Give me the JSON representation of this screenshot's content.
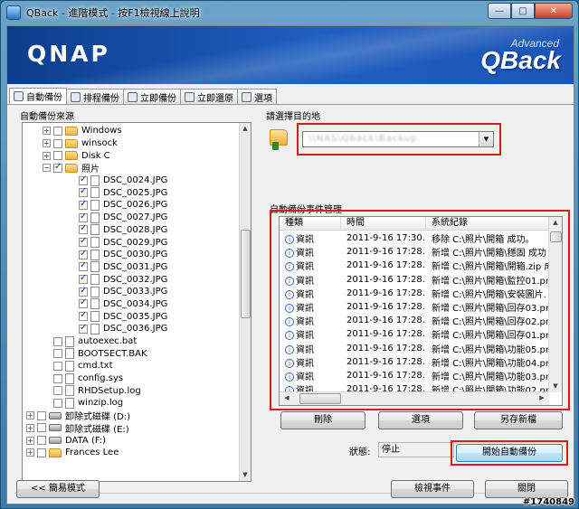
{
  "window": {
    "title": "QBack - 進階模式 - 按F1檢視線上說明",
    "minimize": "—",
    "maximize": "□",
    "close": "✕"
  },
  "banner": {
    "brand": "QNAP",
    "product_small": "Advanced",
    "product_big": "QBack"
  },
  "tabs": [
    {
      "label": "自動備份",
      "active": true
    },
    {
      "label": "排程備份",
      "active": false
    },
    {
      "label": "立即備份",
      "active": false
    },
    {
      "label": "立即還原",
      "active": false
    },
    {
      "label": "選項",
      "active": false
    }
  ],
  "source": {
    "title": "自動備份來源",
    "items": [
      {
        "label": "Windows",
        "depth": 1,
        "icon": "folder",
        "expander": "+",
        "checked": false
      },
      {
        "label": "winsock",
        "depth": 1,
        "icon": "folder",
        "expander": "+",
        "checked": false
      },
      {
        "label": "Disk C",
        "depth": 1,
        "icon": "folder",
        "expander": "+",
        "checked": false
      },
      {
        "label": "照片",
        "depth": 1,
        "icon": "folder",
        "expander": "−",
        "checked": true
      },
      {
        "label": "DSC_0024.JPG",
        "depth": 2,
        "icon": "file",
        "expander": "",
        "checked": true
      },
      {
        "label": "DSC_0025.JPG",
        "depth": 2,
        "icon": "file",
        "expander": "",
        "checked": true
      },
      {
        "label": "DSC_0026.JPG",
        "depth": 2,
        "icon": "file",
        "expander": "",
        "checked": true
      },
      {
        "label": "DSC_0027.JPG",
        "depth": 2,
        "icon": "file",
        "expander": "",
        "checked": true
      },
      {
        "label": "DSC_0028.JPG",
        "depth": 2,
        "icon": "file",
        "expander": "",
        "checked": true
      },
      {
        "label": "DSC_0029.JPG",
        "depth": 2,
        "icon": "file",
        "expander": "",
        "checked": true
      },
      {
        "label": "DSC_0030.JPG",
        "depth": 2,
        "icon": "file",
        "expander": "",
        "checked": true
      },
      {
        "label": "DSC_0031.JPG",
        "depth": 2,
        "icon": "file",
        "expander": "",
        "checked": true
      },
      {
        "label": "DSC_0032.JPG",
        "depth": 2,
        "icon": "file",
        "expander": "",
        "checked": true
      },
      {
        "label": "DSC_0033.JPG",
        "depth": 2,
        "icon": "file",
        "expander": "",
        "checked": true
      },
      {
        "label": "DSC_0034.JPG",
        "depth": 2,
        "icon": "file",
        "expander": "",
        "checked": true
      },
      {
        "label": "DSC_0035.JPG",
        "depth": 2,
        "icon": "file",
        "expander": "",
        "checked": true
      },
      {
        "label": "DSC_0036.JPG",
        "depth": 2,
        "icon": "file",
        "expander": "",
        "checked": true
      },
      {
        "label": "autoexec.bat",
        "depth": 1,
        "icon": "file",
        "expander": "",
        "checked": false
      },
      {
        "label": "BOOTSECT.BAK",
        "depth": 1,
        "icon": "file",
        "expander": "",
        "checked": false
      },
      {
        "label": "cmd.txt",
        "depth": 1,
        "icon": "file",
        "expander": "",
        "checked": false
      },
      {
        "label": "config.sys",
        "depth": 1,
        "icon": "file",
        "expander": "",
        "checked": false
      },
      {
        "label": "RHDSetup.log",
        "depth": 1,
        "icon": "file",
        "expander": "",
        "checked": false
      },
      {
        "label": "winzip.log",
        "depth": 1,
        "icon": "file",
        "expander": "",
        "checked": false
      },
      {
        "label": "卸除式磁碟 (D:)",
        "depth": 0,
        "icon": "drive",
        "expander": "+",
        "checked": false
      },
      {
        "label": "卸除式磁碟 (E:)",
        "depth": 0,
        "icon": "drive",
        "expander": "+",
        "checked": false
      },
      {
        "label": "DATA (F:)",
        "depth": 0,
        "icon": "drive",
        "expander": "+",
        "checked": false
      },
      {
        "label": "Frances Lee",
        "depth": 0,
        "icon": "folder",
        "expander": "+",
        "checked": false
      }
    ]
  },
  "destination": {
    "label": "請選擇目的地",
    "value": "\\\\NAS\\Qback\\Backup"
  },
  "log": {
    "label": "自動備份事件管理",
    "columns": [
      "種類",
      "時間",
      "系統紀錄"
    ],
    "rows": [
      {
        "type": "資訊",
        "time": "2011-9-16 17:30...",
        "message": "移除 C:\\照片\\開箱 成功。"
      },
      {
        "type": "資訊",
        "time": "2011-9-16 17:28...",
        "message": "新增 C:\\照片\\開箱\\穩固 成功"
      },
      {
        "type": "資訊",
        "time": "2011-9-16 17:28...",
        "message": "新增 C:\\照片\\開箱\\開箱.zip 成"
      },
      {
        "type": "資訊",
        "time": "2011-9-16 17:28...",
        "message": "新增 C:\\照片\\開箱\\監控01.pn"
      },
      {
        "type": "資訊",
        "time": "2011-9-16 17:28...",
        "message": "新增 C:\\照片\\開箱\\安裝圖片."
      },
      {
        "type": "資訊",
        "time": "2011-9-16 17:28...",
        "message": "新增 C:\\照片\\開箱\\回存03.pn"
      },
      {
        "type": "資訊",
        "time": "2011-9-16 17:28...",
        "message": "新增 C:\\照片\\開箱\\回存02.pn"
      },
      {
        "type": "資訊",
        "time": "2011-9-16 17:28...",
        "message": "新增 C:\\照片\\開箱\\回存01.pn"
      },
      {
        "type": "資訊",
        "time": "2011-9-16 17:28...",
        "message": "新增 C:\\照片\\開箱\\功能05.pn"
      },
      {
        "type": "資訊",
        "time": "2011-9-16 17:28...",
        "message": "新增 C:\\照片\\開箱\\功能04.pn"
      },
      {
        "type": "資訊",
        "time": "2011-9-16 17:28...",
        "message": "新增 C:\\照片\\開箱\\功能03.pn"
      },
      {
        "type": "資訊",
        "time": "2011-9-16 17:28...",
        "message": "新增 C:\\照片\\開箱\\功能02.pn"
      }
    ]
  },
  "log_buttons": {
    "delete": "刪除",
    "options": "選項",
    "save_new": "另存新檔"
  },
  "status": {
    "label": "狀態:",
    "value": "停止"
  },
  "start_button": "開始自動備份",
  "footer": {
    "simple_mode": "<< 簡易模式",
    "view_events": "檢視事件",
    "close": "關閉"
  },
  "watermark": "#1740849",
  "colors": {
    "highlight": "#e01818",
    "banner": "#1f5fc0"
  }
}
